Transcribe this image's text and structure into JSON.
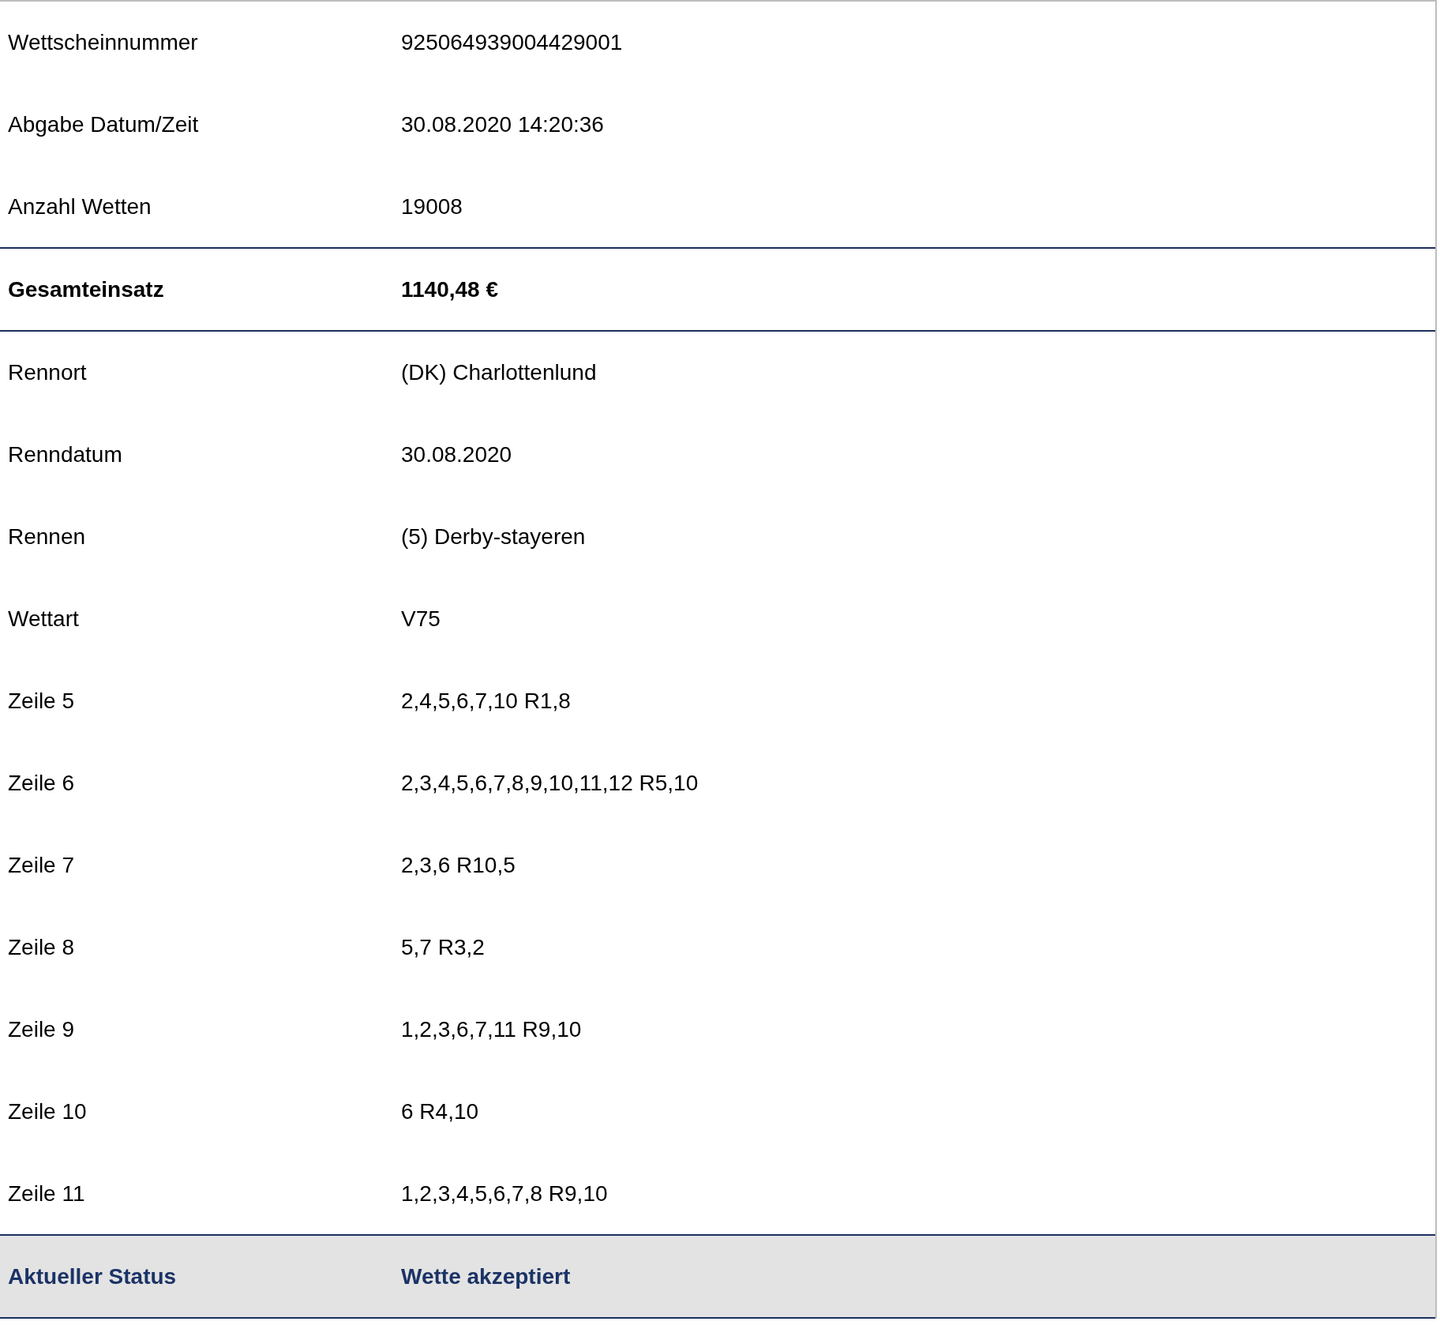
{
  "rows": [
    {
      "kind": "plain",
      "label": "Wettscheinnummer",
      "value": "925064939004429001"
    },
    {
      "kind": "plain",
      "label": "Abgabe Datum/Zeit",
      "value": "30.08.2020 14:20:36"
    },
    {
      "kind": "plain",
      "label": "Anzahl Wetten",
      "value": "19008"
    },
    {
      "kind": "total",
      "label": "Gesamteinsatz",
      "value": "1140,48 €"
    },
    {
      "kind": "plain",
      "label": "Rennort",
      "value": "(DK) Charlottenlund"
    },
    {
      "kind": "plain",
      "label": "Renndatum",
      "value": "30.08.2020"
    },
    {
      "kind": "plain",
      "label": "Rennen",
      "value": "(5) Derby-stayeren"
    },
    {
      "kind": "plain",
      "label": "Wettart",
      "value": "V75"
    },
    {
      "kind": "plain",
      "label": "Zeile 5",
      "value": "2,4,5,6,7,10 R1,8"
    },
    {
      "kind": "plain",
      "label": "Zeile 6",
      "value": "2,3,4,5,6,7,8,9,10,11,12 R5,10"
    },
    {
      "kind": "plain",
      "label": "Zeile 7",
      "value": "2,3,6 R10,5"
    },
    {
      "kind": "plain",
      "label": "Zeile 8",
      "value": "5,7 R3,2"
    },
    {
      "kind": "plain",
      "label": "Zeile 9",
      "value": "1,2,3,6,7,11 R9,10"
    },
    {
      "kind": "plain",
      "label": "Zeile 10",
      "value": "6 R4,10"
    },
    {
      "kind": "plain",
      "label": "Zeile 11",
      "value": "1,2,3,4,5,6,7,8 R9,10"
    },
    {
      "kind": "status",
      "label": "Aktueller Status",
      "value": "Wette akzeptiert"
    }
  ]
}
